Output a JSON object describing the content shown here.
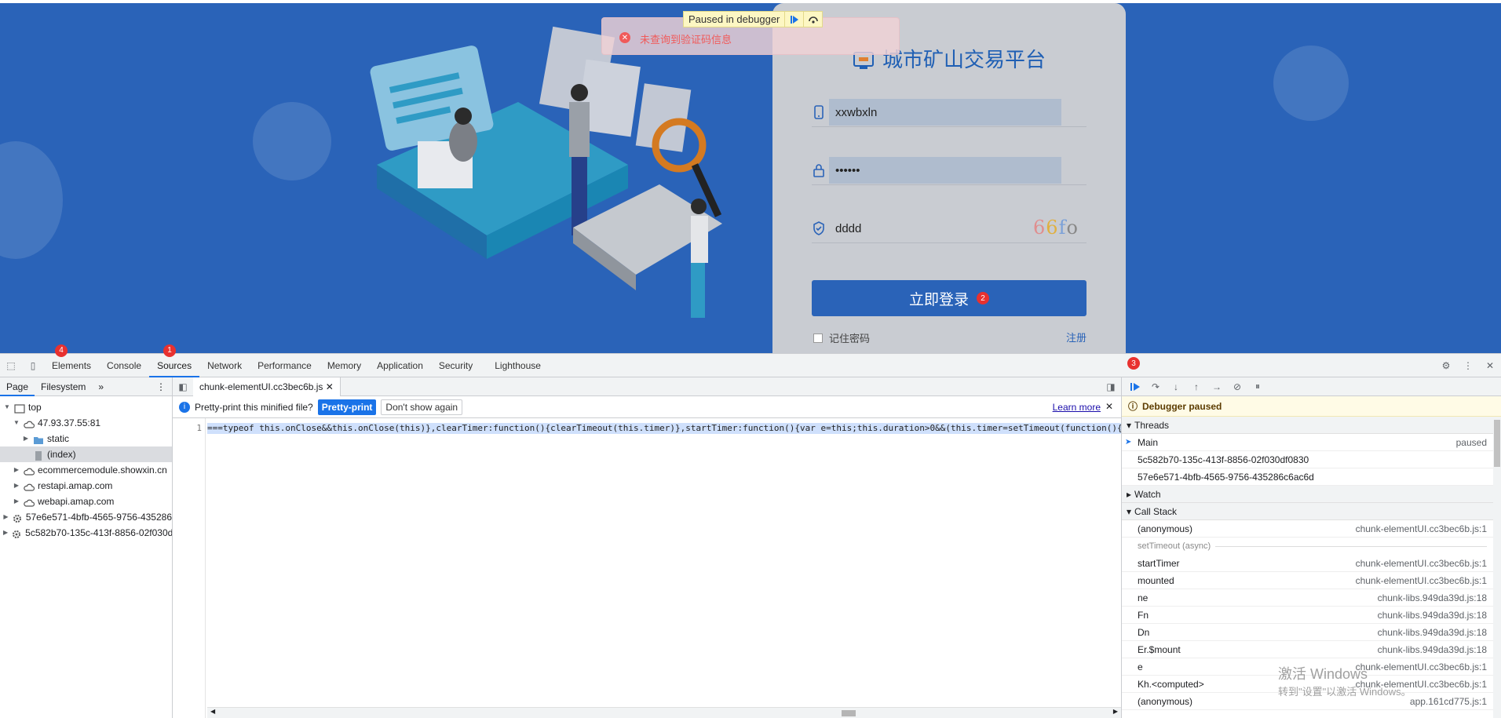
{
  "page": {
    "platform_title": "城市矿山交易平台",
    "username_value": "xxwbxln",
    "password_value": "••••••",
    "captcha_input_value": "dddd",
    "captcha_text": "66fo",
    "login_button": "立即登录",
    "remember_label": "记住密码",
    "register_link": "注册",
    "toast_message": "未查询到验证码信息",
    "paused_overlay": "Paused in debugger",
    "colors": {
      "background": "#2a63b8",
      "accent": "#1f5fb4",
      "toast": "#f05a5a"
    }
  },
  "badges": {
    "b1": "1",
    "b2": "2",
    "b3": "3",
    "b4": "4"
  },
  "devtools": {
    "tabs": [
      "Elements",
      "Console",
      "Sources",
      "Network",
      "Performance",
      "Memory",
      "Application",
      "Security",
      "Lighthouse"
    ],
    "active_tab": "Sources",
    "nav_tabs": {
      "page": "Page",
      "filesystem": "Filesystem",
      "more": "»"
    },
    "tree": [
      {
        "label": "top",
        "depth": 0,
        "icon": "frame-icon",
        "open": true
      },
      {
        "label": "47.93.37.55:81",
        "depth": 1,
        "icon": "cloud-icon",
        "open": true
      },
      {
        "label": "static",
        "depth": 2,
        "icon": "folder-icon",
        "open": false
      },
      {
        "label": "(index)",
        "depth": 2,
        "icon": "file-icon",
        "selected": true
      },
      {
        "label": "ecommercemodule.showxin.cn",
        "depth": 1,
        "icon": "cloud-icon",
        "open": false
      },
      {
        "label": "restapi.amap.com",
        "depth": 1,
        "icon": "cloud-icon",
        "open": false
      },
      {
        "label": "webapi.amap.com",
        "depth": 1,
        "icon": "cloud-icon",
        "open": false
      },
      {
        "label": "57e6e571-4bfb-4565-9756-435286",
        "depth": 0,
        "icon": "gear-icon",
        "open": false
      },
      {
        "label": "5c582b70-135c-413f-8856-02f030d",
        "depth": 0,
        "icon": "gear-icon",
        "open": false
      }
    ],
    "file_tab": "chunk-elementUI.cc3bec6b.js",
    "info_text": "Pretty-print this minified file?",
    "pretty_print": "Pretty-print",
    "dont_show": "Don't show again",
    "learn_more": "Learn more",
    "line_number": "1",
    "code_line": "===typeof this.onClose&&this.onClose(this)},clearTimer:function(){clearTimeout(this.timer)},startTimer:function(){var e=this;this.duration>0&&(this.timer=setTimeout(function(){e",
    "debugger_paused": "Debugger paused",
    "threads_label": "Threads",
    "threads": [
      {
        "name": "Main",
        "status": "paused"
      },
      {
        "name": "5c582b70-135c-413f-8856-02f030df0830",
        "status": ""
      },
      {
        "name": "57e6e571-4bfb-4565-9756-435286c6ac6d",
        "status": ""
      }
    ],
    "watch_label": "Watch",
    "callstack_label": "Call Stack",
    "async_label": "setTimeout (async)",
    "callstack": [
      {
        "fn": "(anonymous)",
        "loc": "chunk-elementUI.cc3bec6b.js:1"
      },
      {
        "fn": "startTimer",
        "loc": "chunk-elementUI.cc3bec6b.js:1"
      },
      {
        "fn": "mounted",
        "loc": "chunk-elementUI.cc3bec6b.js:1"
      },
      {
        "fn": "ne",
        "loc": "chunk-libs.949da39d.js:18"
      },
      {
        "fn": "Fn",
        "loc": "chunk-libs.949da39d.js:18"
      },
      {
        "fn": "Dn",
        "loc": "chunk-libs.949da39d.js:18"
      },
      {
        "fn": "Er.$mount",
        "loc": "chunk-libs.949da39d.js:18"
      },
      {
        "fn": "e",
        "loc": "chunk-elementUI.cc3bec6b.js:1"
      },
      {
        "fn": "Kh.<computed>",
        "loc": "chunk-elementUI.cc3bec6b.js:1"
      },
      {
        "fn": "(anonymous)",
        "loc": "app.161cd775.js:1"
      }
    ]
  },
  "watermark": {
    "title": "激活 Windows",
    "subtitle": "转到\"设置\"以激活 Windows。"
  }
}
